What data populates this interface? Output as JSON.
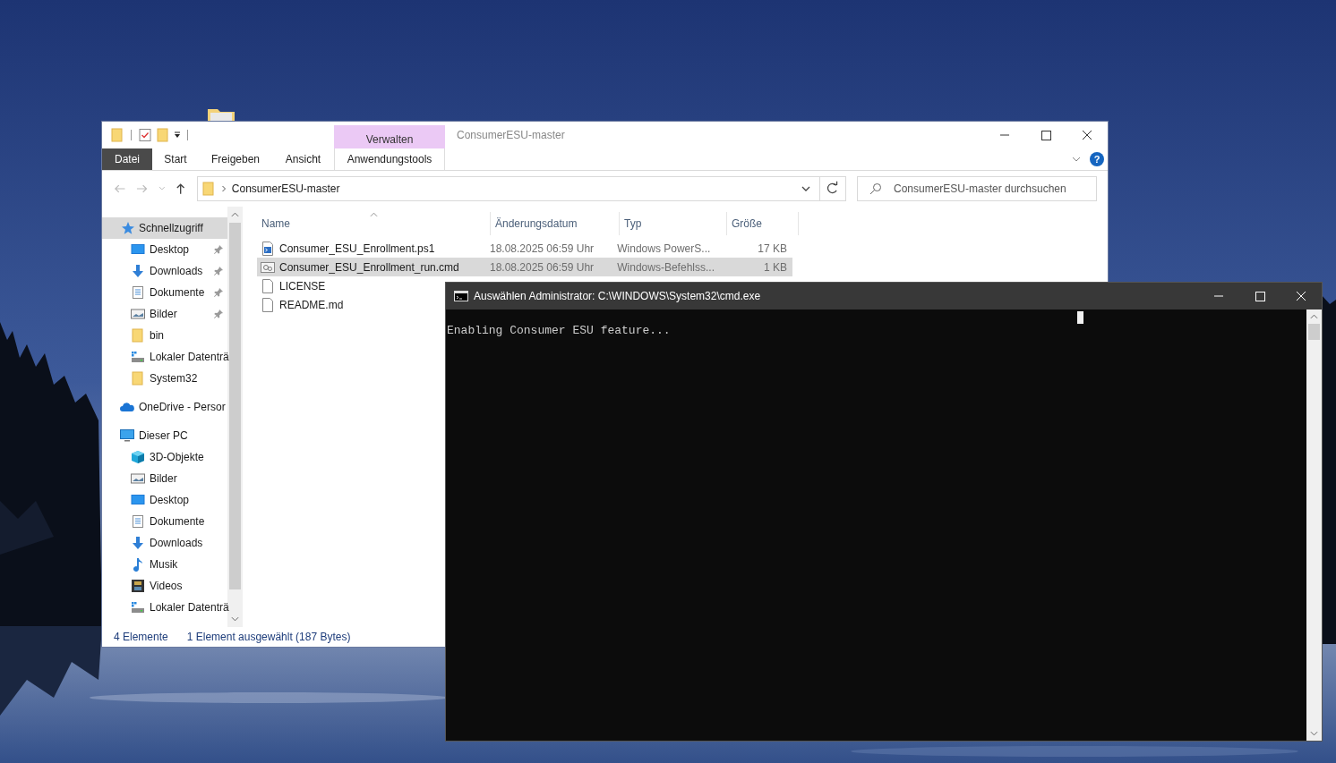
{
  "explorer": {
    "title": "ConsumerESU-master",
    "context_tab": {
      "group": "Verwalten",
      "label": "Anwendungstools"
    },
    "ribbon_tabs": [
      {
        "label": "Datei",
        "kind": "file"
      },
      {
        "label": "Start",
        "kind": "tab"
      },
      {
        "label": "Freigeben",
        "kind": "tab"
      },
      {
        "label": "Ansicht",
        "kind": "tab"
      }
    ],
    "help": "?",
    "address": {
      "path": "ConsumerESU-master"
    },
    "search": {
      "placeholder": "ConsumerESU-master durchsuchen"
    },
    "sidebar": [
      {
        "label": "Schnellzugriff",
        "kind": "star",
        "selected": true,
        "children": [
          {
            "label": "Desktop",
            "kind": "desktop",
            "pinned": true,
            "selected": false
          },
          {
            "label": "Downloads",
            "kind": "downloads",
            "pinned": true,
            "selected": false
          },
          {
            "label": "Dokumente",
            "kind": "documents",
            "pinned": true,
            "selected": false
          },
          {
            "label": "Bilder",
            "kind": "pictures",
            "pinned": true,
            "selected": false
          },
          {
            "label": "bin",
            "kind": "folder",
            "pinned": false,
            "selected": false
          },
          {
            "label": "Lokaler Datenträ",
            "kind": "drive",
            "pinned": false,
            "selected": false
          },
          {
            "label": "System32",
            "kind": "folder",
            "pinned": false,
            "selected": false
          }
        ]
      },
      {
        "label": "OneDrive - Persor",
        "kind": "onedrive",
        "selected": false
      },
      {
        "label": "Dieser PC",
        "kind": "pc",
        "selected": false,
        "children": [
          {
            "label": "3D-Objekte",
            "kind": "objects3d",
            "selected": false
          },
          {
            "label": "Bilder",
            "kind": "pictures",
            "selected": false
          },
          {
            "label": "Desktop",
            "kind": "desktop",
            "selected": false
          },
          {
            "label": "Dokumente",
            "kind": "documents",
            "selected": false
          },
          {
            "label": "Downloads",
            "kind": "downloads",
            "selected": false
          },
          {
            "label": "Musik",
            "kind": "music",
            "selected": false
          },
          {
            "label": "Videos",
            "kind": "videos",
            "selected": false
          },
          {
            "label": "Lokaler Datenträ",
            "kind": "drive",
            "selected": false
          }
        ]
      }
    ],
    "columns": [
      {
        "label": "Name",
        "sorted": true
      },
      {
        "label": "Änderungsdatum",
        "sorted": false
      },
      {
        "label": "Typ",
        "sorted": false
      },
      {
        "label": "Größe",
        "sorted": false
      }
    ],
    "files": [
      {
        "name": "Consumer_ESU_Enrollment.ps1",
        "date": "18.08.2025 06:59 Uhr",
        "type": "Windows PowerS...",
        "size": "17 KB",
        "kind": "script",
        "selected": false
      },
      {
        "name": "Consumer_ESU_Enrollment_run.cmd",
        "date": "18.08.2025 06:59 Uhr",
        "type": "Windows-Befehlss...",
        "size": "1 KB",
        "kind": "command",
        "selected": true
      },
      {
        "name": "LICENSE",
        "kind": "file",
        "selected": false
      },
      {
        "name": "README.md",
        "kind": "file",
        "selected": false
      }
    ],
    "status": {
      "count": "4 Elemente",
      "selection": "1 Element ausgewählt (187 Bytes)"
    }
  },
  "console": {
    "title": "Auswählen Administrator: C:\\WINDOWS\\System32\\cmd.exe",
    "lines": [
      "Enabling Consumer ESU feature..."
    ]
  }
}
